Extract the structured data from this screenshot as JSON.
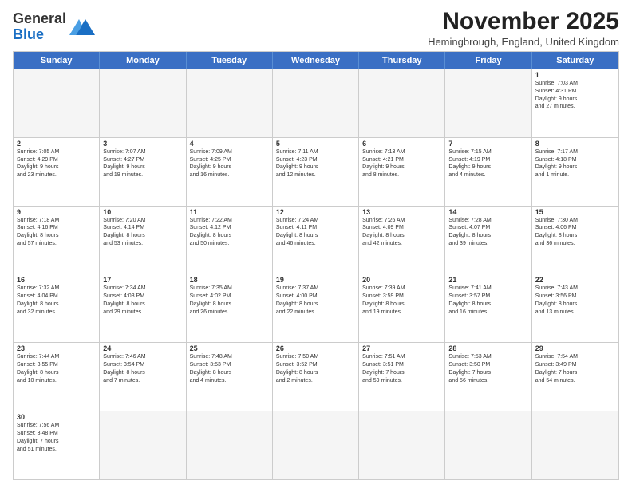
{
  "header": {
    "logo_general": "General",
    "logo_blue": "Blue",
    "title": "November 2025",
    "subtitle": "Hemingbrough, England, United Kingdom"
  },
  "weekdays": [
    "Sunday",
    "Monday",
    "Tuesday",
    "Wednesday",
    "Thursday",
    "Friday",
    "Saturday"
  ],
  "weeks": [
    [
      {
        "day": "",
        "info": "",
        "empty": true
      },
      {
        "day": "",
        "info": "",
        "empty": true
      },
      {
        "day": "",
        "info": "",
        "empty": true
      },
      {
        "day": "",
        "info": "",
        "empty": true
      },
      {
        "day": "",
        "info": "",
        "empty": true
      },
      {
        "day": "",
        "info": "",
        "empty": true
      },
      {
        "day": "1",
        "info": "Sunrise: 7:03 AM\nSunset: 4:31 PM\nDaylight: 9 hours\nand 27 minutes.",
        "empty": false
      }
    ],
    [
      {
        "day": "2",
        "info": "Sunrise: 7:05 AM\nSunset: 4:29 PM\nDaylight: 9 hours\nand 23 minutes.",
        "empty": false
      },
      {
        "day": "3",
        "info": "Sunrise: 7:07 AM\nSunset: 4:27 PM\nDaylight: 9 hours\nand 19 minutes.",
        "empty": false
      },
      {
        "day": "4",
        "info": "Sunrise: 7:09 AM\nSunset: 4:25 PM\nDaylight: 9 hours\nand 16 minutes.",
        "empty": false
      },
      {
        "day": "5",
        "info": "Sunrise: 7:11 AM\nSunset: 4:23 PM\nDaylight: 9 hours\nand 12 minutes.",
        "empty": false
      },
      {
        "day": "6",
        "info": "Sunrise: 7:13 AM\nSunset: 4:21 PM\nDaylight: 9 hours\nand 8 minutes.",
        "empty": false
      },
      {
        "day": "7",
        "info": "Sunrise: 7:15 AM\nSunset: 4:19 PM\nDaylight: 9 hours\nand 4 minutes.",
        "empty": false
      },
      {
        "day": "8",
        "info": "Sunrise: 7:17 AM\nSunset: 4:18 PM\nDaylight: 9 hours\nand 1 minute.",
        "empty": false
      }
    ],
    [
      {
        "day": "9",
        "info": "Sunrise: 7:18 AM\nSunset: 4:16 PM\nDaylight: 8 hours\nand 57 minutes.",
        "empty": false
      },
      {
        "day": "10",
        "info": "Sunrise: 7:20 AM\nSunset: 4:14 PM\nDaylight: 8 hours\nand 53 minutes.",
        "empty": false
      },
      {
        "day": "11",
        "info": "Sunrise: 7:22 AM\nSunset: 4:12 PM\nDaylight: 8 hours\nand 50 minutes.",
        "empty": false
      },
      {
        "day": "12",
        "info": "Sunrise: 7:24 AM\nSunset: 4:11 PM\nDaylight: 8 hours\nand 46 minutes.",
        "empty": false
      },
      {
        "day": "13",
        "info": "Sunrise: 7:26 AM\nSunset: 4:09 PM\nDaylight: 8 hours\nand 42 minutes.",
        "empty": false
      },
      {
        "day": "14",
        "info": "Sunrise: 7:28 AM\nSunset: 4:07 PM\nDaylight: 8 hours\nand 39 minutes.",
        "empty": false
      },
      {
        "day": "15",
        "info": "Sunrise: 7:30 AM\nSunset: 4:06 PM\nDaylight: 8 hours\nand 36 minutes.",
        "empty": false
      }
    ],
    [
      {
        "day": "16",
        "info": "Sunrise: 7:32 AM\nSunset: 4:04 PM\nDaylight: 8 hours\nand 32 minutes.",
        "empty": false
      },
      {
        "day": "17",
        "info": "Sunrise: 7:34 AM\nSunset: 4:03 PM\nDaylight: 8 hours\nand 29 minutes.",
        "empty": false
      },
      {
        "day": "18",
        "info": "Sunrise: 7:35 AM\nSunset: 4:02 PM\nDaylight: 8 hours\nand 26 minutes.",
        "empty": false
      },
      {
        "day": "19",
        "info": "Sunrise: 7:37 AM\nSunset: 4:00 PM\nDaylight: 8 hours\nand 22 minutes.",
        "empty": false
      },
      {
        "day": "20",
        "info": "Sunrise: 7:39 AM\nSunset: 3:59 PM\nDaylight: 8 hours\nand 19 minutes.",
        "empty": false
      },
      {
        "day": "21",
        "info": "Sunrise: 7:41 AM\nSunset: 3:57 PM\nDaylight: 8 hours\nand 16 minutes.",
        "empty": false
      },
      {
        "day": "22",
        "info": "Sunrise: 7:43 AM\nSunset: 3:56 PM\nDaylight: 8 hours\nand 13 minutes.",
        "empty": false
      }
    ],
    [
      {
        "day": "23",
        "info": "Sunrise: 7:44 AM\nSunset: 3:55 PM\nDaylight: 8 hours\nand 10 minutes.",
        "empty": false
      },
      {
        "day": "24",
        "info": "Sunrise: 7:46 AM\nSunset: 3:54 PM\nDaylight: 8 hours\nand 7 minutes.",
        "empty": false
      },
      {
        "day": "25",
        "info": "Sunrise: 7:48 AM\nSunset: 3:53 PM\nDaylight: 8 hours\nand 4 minutes.",
        "empty": false
      },
      {
        "day": "26",
        "info": "Sunrise: 7:50 AM\nSunset: 3:52 PM\nDaylight: 8 hours\nand 2 minutes.",
        "empty": false
      },
      {
        "day": "27",
        "info": "Sunrise: 7:51 AM\nSunset: 3:51 PM\nDaylight: 7 hours\nand 59 minutes.",
        "empty": false
      },
      {
        "day": "28",
        "info": "Sunrise: 7:53 AM\nSunset: 3:50 PM\nDaylight: 7 hours\nand 56 minutes.",
        "empty": false
      },
      {
        "day": "29",
        "info": "Sunrise: 7:54 AM\nSunset: 3:49 PM\nDaylight: 7 hours\nand 54 minutes.",
        "empty": false
      }
    ],
    [
      {
        "day": "30",
        "info": "Sunrise: 7:56 AM\nSunset: 3:48 PM\nDaylight: 7 hours\nand 51 minutes.",
        "empty": false
      },
      {
        "day": "",
        "info": "",
        "empty": true
      },
      {
        "day": "",
        "info": "",
        "empty": true
      },
      {
        "day": "",
        "info": "",
        "empty": true
      },
      {
        "day": "",
        "info": "",
        "empty": true
      },
      {
        "day": "",
        "info": "",
        "empty": true
      },
      {
        "day": "",
        "info": "",
        "empty": true
      }
    ]
  ]
}
